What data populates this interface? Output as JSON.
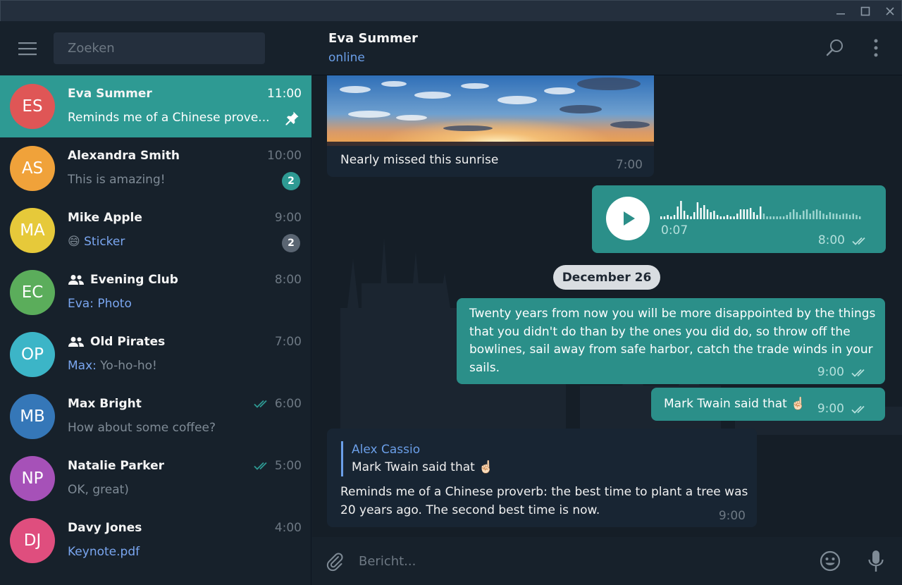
{
  "colors": {
    "accent": "#2e9a93",
    "link": "#6b9fe8",
    "sidebar_bg": "#17212b",
    "chat_bg": "#0e1621"
  },
  "search": {
    "placeholder": "Zoeken"
  },
  "chats": [
    {
      "initials": "ES",
      "name": "Eva Summer",
      "time": "11:00",
      "preview": "Reminds me of a Chinese prove...",
      "avatar_color": "#df5656",
      "pinned": true
    },
    {
      "initials": "AS",
      "name": "Alexandra Smith",
      "time": "10:00",
      "preview": "This is amazing!",
      "avatar_color": "#f0a23a",
      "badge": "2",
      "badge_color": "#2e9a93"
    },
    {
      "initials": "MA",
      "name": "Mike Apple",
      "time": "9:00",
      "preview_emoji": "😄",
      "preview_accent": "Sticker",
      "avatar_color": "#e6c93a",
      "badge": "2",
      "badge_color": "#5a6572"
    },
    {
      "initials": "EC",
      "name": "Evening Club",
      "group": true,
      "time": "8:00",
      "preview_accent": "Eva: Photo",
      "avatar_color": "#5bad5b"
    },
    {
      "initials": "OP",
      "name": "Old Pirates",
      "group": true,
      "time": "7:00",
      "preview_accent": "Max:",
      "preview": "Yo-ho-ho!",
      "avatar_color": "#3cb5c7"
    },
    {
      "initials": "MB",
      "name": "Max Bright",
      "time": "6:00",
      "read": true,
      "preview": "How about some coffee?",
      "avatar_color": "#3577b8"
    },
    {
      "initials": "NP",
      "name": "Natalie Parker",
      "time": "5:00",
      "read": true,
      "preview": "OK, great)",
      "avatar_color": "#a651b8"
    },
    {
      "initials": "DJ",
      "name": "Davy Jones",
      "time": "4:00",
      "preview_accent": "Keynote.pdf",
      "avatar_color": "#df4e7e"
    }
  ],
  "header": {
    "name": "Eva Summer",
    "status": "online"
  },
  "messages": {
    "photo": {
      "caption": "Nearly missed this sunrise",
      "time": "7:00"
    },
    "voice": {
      "duration": "0:07",
      "time": "8:00"
    },
    "date_separator": "December 26",
    "quote": {
      "text": "Twenty years from now you will be more disappointed by the things that you didn't do than by the ones you did do, so throw off the bowlines, sail away from safe harbor, catch the trade winds in your sails.",
      "time": "9:00"
    },
    "twain": {
      "text": "Mark Twain said that",
      "emoji": "☝🏻",
      "time": "9:00"
    },
    "reply": {
      "author": "Alex Cassio",
      "quoted": "Mark Twain said that",
      "quoted_emoji": "☝🏻",
      "text": "Reminds me of a Chinese proverb: the best time to plant a tree was 20 years ago. The second best time is now.",
      "time": "9:00"
    }
  },
  "composer": {
    "placeholder": "Bericht..."
  }
}
